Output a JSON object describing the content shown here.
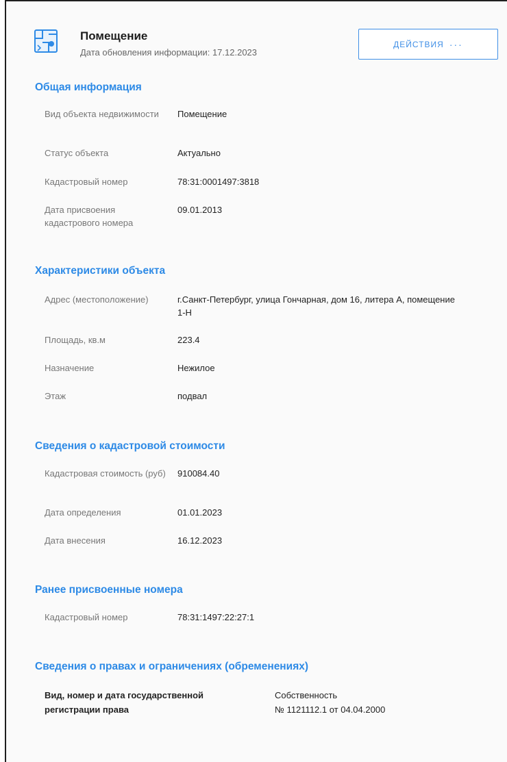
{
  "header": {
    "title": "Помещение",
    "subtitle": "Дата обновления информации: 17.12.2023",
    "actions_label": "действия",
    "actions_dots": "···",
    "icon": "building-plan-icon"
  },
  "colors": {
    "accent": "#2d8ae6",
    "label": "#777777",
    "text": "#222222"
  },
  "sections": [
    {
      "title": "Общая информация",
      "rows": [
        {
          "label": "Вид объекта недвижимости",
          "value": "Помещение"
        },
        {
          "label": "Статус объекта",
          "value": "Актуально"
        },
        {
          "label": "Кадастровый номер",
          "value": "78:31:0001497:3818"
        },
        {
          "label": "Дата присвоения кадастрового номера",
          "value": "09.01.2013"
        }
      ]
    },
    {
      "title": "Характеристики объекта",
      "rows": [
        {
          "label": "Адрес (местоположение)",
          "value": "г.Санкт-Петербург, улица Гончарная, дом 16, литера А, помещение 1-Н"
        },
        {
          "label": "Площадь, кв.м",
          "value": "223.4"
        },
        {
          "label": "Назначение",
          "value": "Нежилое"
        },
        {
          "label": "Этаж",
          "value": "подвал"
        }
      ]
    },
    {
      "title": "Сведения о кадастровой стоимости",
      "rows": [
        {
          "label": "Кадастровая стоимость (руб)",
          "value": "910084.40"
        },
        {
          "label": "Дата определения",
          "value": "01.01.2023"
        },
        {
          "label": "Дата внесения",
          "value": "16.12.2023"
        }
      ]
    },
    {
      "title": "Ранее присвоенные номера",
      "rows": [
        {
          "label": "Кадастровый номер",
          "value": "78:31:1497:22:27:1"
        }
      ]
    },
    {
      "title": "Сведения о правах и ограничениях (обременениях)",
      "rows": []
    }
  ],
  "rights": {
    "label_line1": "Вид, номер и дата государственной",
    "label_line2": "регистрации права",
    "value_line1": "Собственность",
    "value_line2": "№ 1121112.1 от 04.04.2000"
  }
}
